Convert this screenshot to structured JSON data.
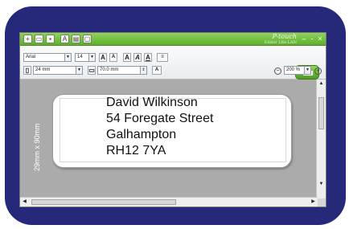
{
  "toolbar": {
    "font_family": "Arial",
    "font_size": "14",
    "tape_width": "24 mm",
    "label_length": "70.0 mm",
    "zoom": "200 %"
  },
  "brand": {
    "name": "P-touch",
    "subtitle": "Editor Lite LAN"
  },
  "label": {
    "dimensions_text": "29mm x 90mm",
    "lines": [
      "David Wilkinson",
      "54 Foregate Street",
      "Galhampton",
      "RH12 7YA"
    ]
  },
  "colors": {
    "frame": "#26287a",
    "titlebar": "#6bbf3a",
    "canvas": "#ababab"
  }
}
